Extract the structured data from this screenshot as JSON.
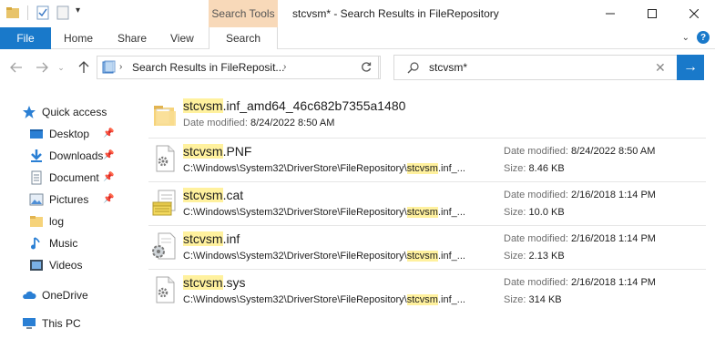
{
  "titlebar": {
    "context_tab_header": "Search Tools",
    "title": "stcvsm* - Search Results in FileRepository"
  },
  "ribbon": {
    "file": "File",
    "home": "Home",
    "share": "Share",
    "view": "View",
    "search": "Search"
  },
  "nav": {
    "address": "Search Results in FileReposit...",
    "search_query": "stcvsm*"
  },
  "sidebar": {
    "quick_access": "Quick access",
    "desktop": "Desktop",
    "downloads": "Downloads",
    "documents": "Document",
    "pictures": "Pictures",
    "log": "log",
    "music": "Music",
    "videos": "Videos",
    "onedrive": "OneDrive",
    "thispc": "This PC"
  },
  "results": {
    "highlight": "stcvsm",
    "date_label": "Date modified:",
    "size_label": "Size:",
    "folder": {
      "name_rest": ".inf_amd64_46c682b7355a1480",
      "date": "8/24/2022 8:50 AM"
    },
    "files": [
      {
        "name_rest": ".PNF",
        "path_prefix": "C:\\Windows\\System32\\DriverStore\\FileRepository\\",
        "path_suffix": ".inf_...",
        "date": "8/24/2022 8:50 AM",
        "size": "8.46 KB"
      },
      {
        "name_rest": ".cat",
        "path_prefix": "C:\\Windows\\System32\\DriverStore\\FileRepository\\",
        "path_suffix": ".inf_...",
        "date": "2/16/2018 1:14 PM",
        "size": "10.0 KB"
      },
      {
        "name_rest": ".inf",
        "path_prefix": "C:\\Windows\\System32\\DriverStore\\FileRepository\\",
        "path_suffix": ".inf_...",
        "date": "2/16/2018 1:14 PM",
        "size": "2.13 KB"
      },
      {
        "name_rest": ".sys",
        "path_prefix": "C:\\Windows\\System32\\DriverStore\\FileRepository\\",
        "path_suffix": ".inf_...",
        "date": "2/16/2018 1:14 PM",
        "size": "314 KB"
      }
    ]
  }
}
